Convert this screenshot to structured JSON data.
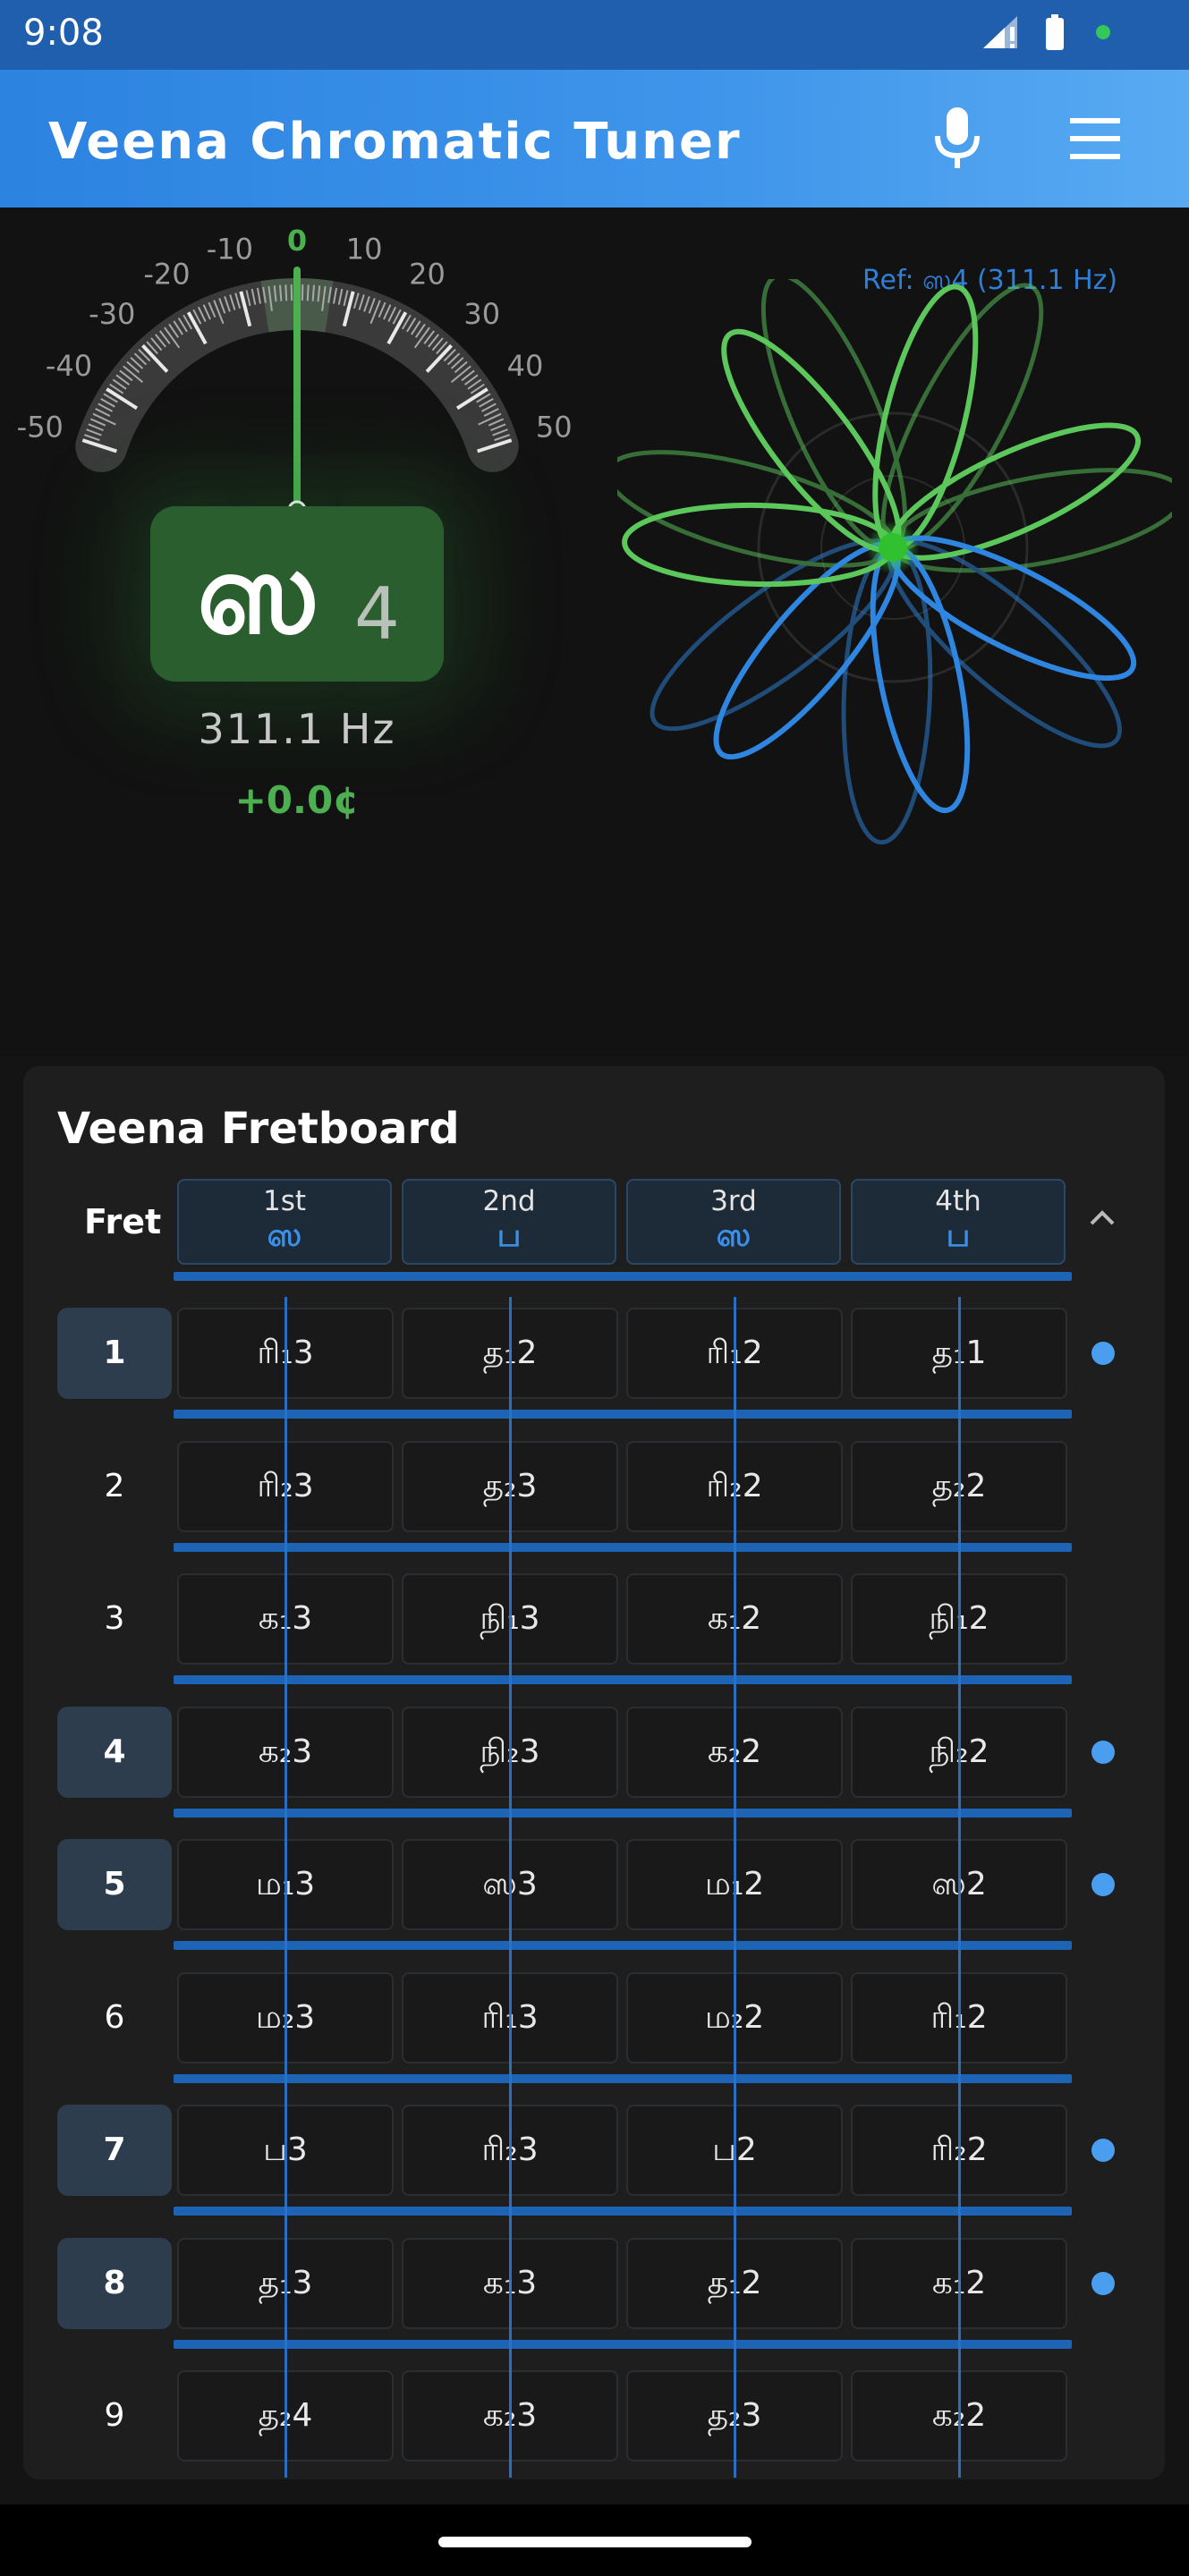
{
  "status": {
    "time": "9:08"
  },
  "appbar": {
    "title": "Veena Chromatic Tuner"
  },
  "tuner": {
    "gauge_ticks": [
      "-50",
      "-40",
      "-30",
      "-20",
      "-10",
      "0",
      "10",
      "20",
      "30",
      "40",
      "50"
    ],
    "needle_cents": 0.0,
    "note": "ஸ",
    "octave": "4",
    "frequency": "311.1 Hz",
    "cents": "+0.0¢",
    "reference": "Ref: ஸ4 (311.1 Hz)"
  },
  "fretboard": {
    "title": "Veena Fretboard",
    "fret_label": "Fret",
    "strings": [
      {
        "ordinal": "1st",
        "note": "ஸ"
      },
      {
        "ordinal": "2nd",
        "note": "ப"
      },
      {
        "ordinal": "3rd",
        "note": "ஸ"
      },
      {
        "ordinal": "4th",
        "note": "ப"
      }
    ],
    "frets": [
      {
        "num": "1",
        "active": true,
        "notes": [
          "ரி₁3",
          "த₁2",
          "ரி₁2",
          "த₁1"
        ]
      },
      {
        "num": "2",
        "active": false,
        "notes": [
          "ரி₂3",
          "த₂3",
          "ரி₂2",
          "த₂2"
        ]
      },
      {
        "num": "3",
        "active": false,
        "notes": [
          "க₁3",
          "நி₁3",
          "க₁2",
          "நி₁2"
        ]
      },
      {
        "num": "4",
        "active": true,
        "notes": [
          "க₂3",
          "நி₂3",
          "க₂2",
          "நி₂2"
        ]
      },
      {
        "num": "5",
        "active": true,
        "notes": [
          "ம₁3",
          "ஸ3",
          "ம₁2",
          "ஸ2"
        ]
      },
      {
        "num": "6",
        "active": false,
        "notes": [
          "ம₂3",
          "ரி₁3",
          "ம₂2",
          "ரி₁2"
        ]
      },
      {
        "num": "7",
        "active": true,
        "notes": [
          "ப3",
          "ரி₂3",
          "ப2",
          "ரி₂2"
        ]
      },
      {
        "num": "8",
        "active": true,
        "notes": [
          "த₁3",
          "க₁3",
          "த₁2",
          "க₁2"
        ]
      },
      {
        "num": "9",
        "active": false,
        "notes": [
          "த₂4",
          "க₂3",
          "த₂3",
          "க₂2"
        ]
      }
    ]
  },
  "colors": {
    "accent": "#3d8fe6",
    "in_tune": "#4caf50",
    "appbar": "#2c83e0"
  }
}
